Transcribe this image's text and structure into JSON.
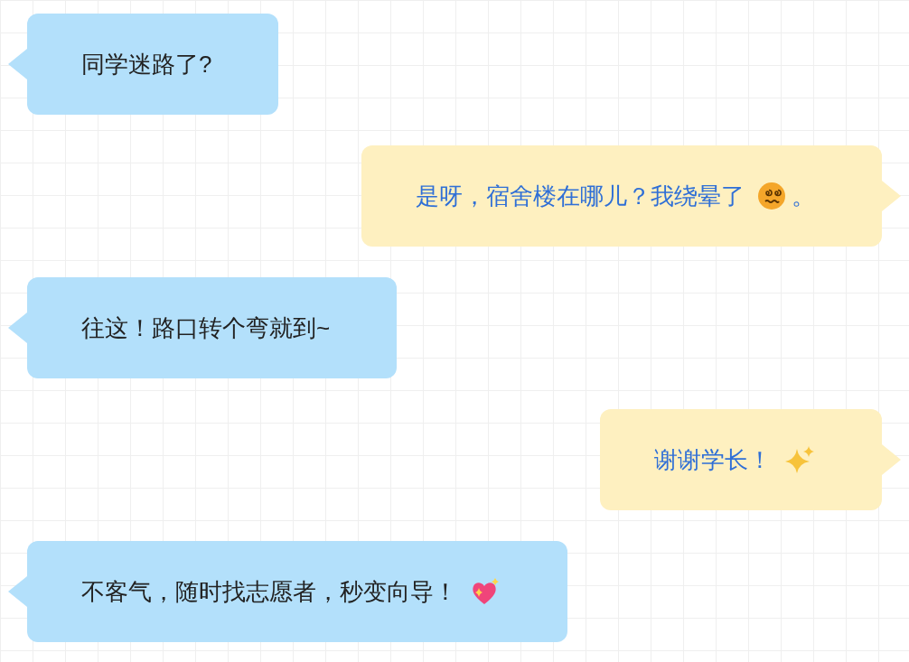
{
  "messages": [
    {
      "kind": "incoming",
      "text": "同学迷路了?"
    },
    {
      "kind": "outgoing",
      "text": "是呀，宿舍楼在哪儿？我绕晕了",
      "emoji": true,
      "text_after": "。"
    },
    {
      "kind": "incoming",
      "text": "往这！路口转个弯就到~"
    },
    {
      "kind": "outgoing",
      "text": "谢谢学长！",
      "emoji": true
    },
    {
      "kind": "incoming",
      "text": "不客气，随时找志愿者，秒变向导！",
      "emoji": true
    }
  ]
}
